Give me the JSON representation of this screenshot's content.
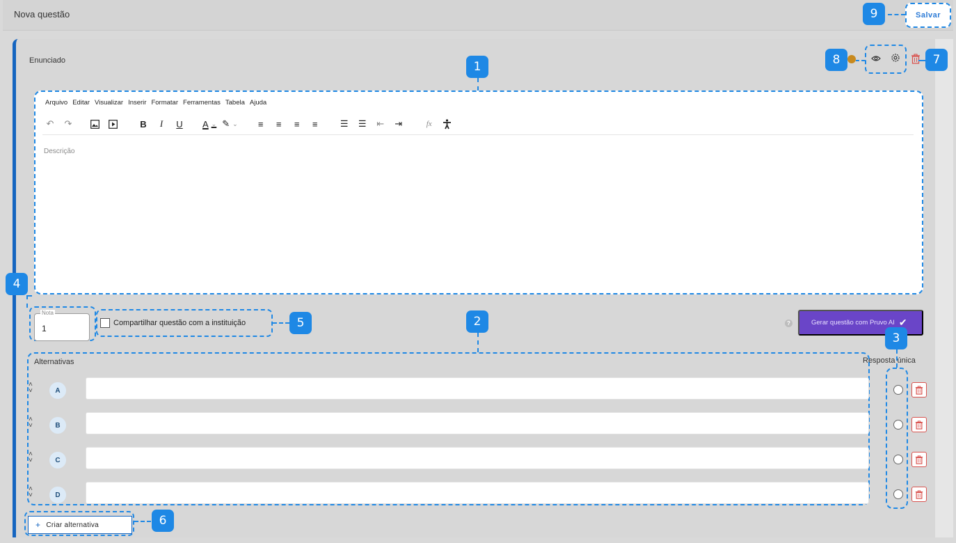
{
  "header": {
    "title": "Nova questão",
    "save_label": "Salvar"
  },
  "question": {
    "section_label": "Enunciado",
    "editor": {
      "menu": [
        "Arquivo",
        "Editar",
        "Visualizar",
        "Inserir",
        "Formatar",
        "Ferramentas",
        "Tabela",
        "Ajuda"
      ],
      "placeholder": "Descrição",
      "toolbar_icons": [
        "undo-icon",
        "redo-icon",
        "image-icon",
        "media-icon",
        "bold-icon",
        "italic-icon",
        "underline-icon",
        "text-color-icon",
        "highlight-icon",
        "align-left-icon",
        "align-center-icon",
        "align-right-icon",
        "align-justify-icon",
        "bullet-list-icon",
        "numbered-list-icon",
        "outdent-icon",
        "indent-icon",
        "formula-icon",
        "accessibility-icon"
      ]
    },
    "nota": {
      "label": "Nota",
      "value": "1"
    },
    "share_label": "Compartilhar questão com a instituição",
    "ai_button_label": "Gerar questão com Pruvo AI",
    "help_glyph": "?",
    "alternatives_label": "Alternativas",
    "single_answer_label": "Resposta única",
    "alternatives": [
      {
        "letter": "A",
        "text": ""
      },
      {
        "letter": "B",
        "text": ""
      },
      {
        "letter": "C",
        "text": ""
      },
      {
        "letter": "D",
        "text": ""
      }
    ],
    "add_alternative_label": "Criar alternativa"
  },
  "badges": [
    "1",
    "2",
    "3",
    "4",
    "5",
    "6",
    "7",
    "8",
    "9"
  ],
  "colors": {
    "accent": "#1e88e5",
    "primary": "#1565c0",
    "ai_button": "#6a45c8",
    "danger": "#d9534f"
  }
}
